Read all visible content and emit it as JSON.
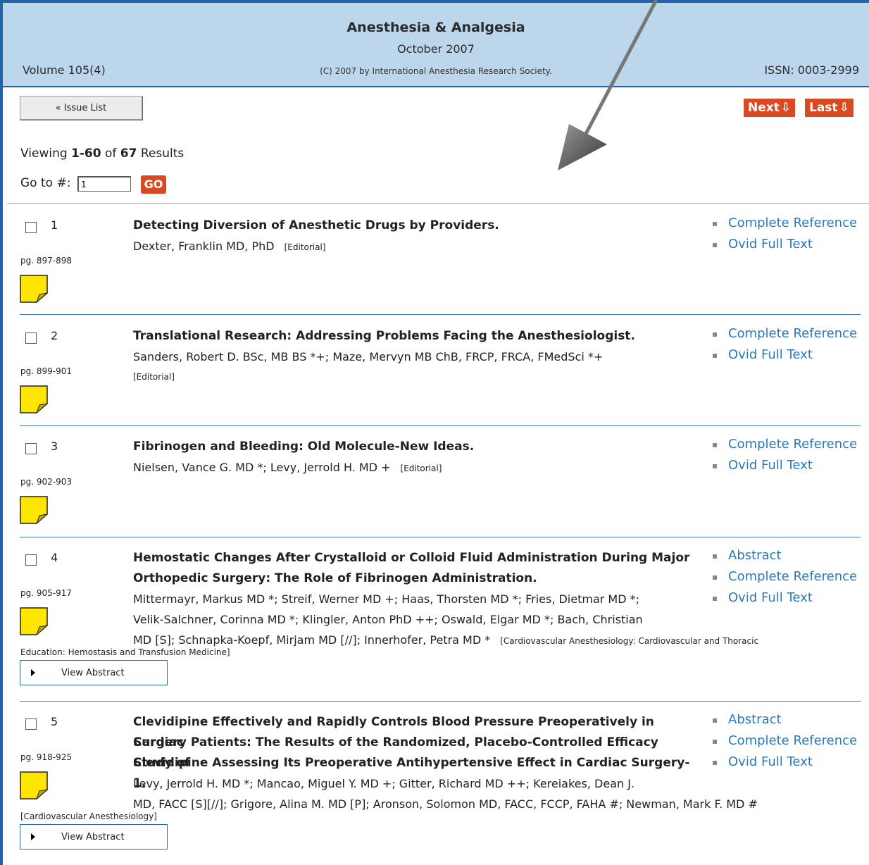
{
  "header": {
    "title": "Anesthesia & Analgesia",
    "date": "October 2007",
    "volume": "Volume 105(4)",
    "copyright": "(C) 2007 by International Anesthesia Research Society.",
    "issn": "ISSN: 0003-2999"
  },
  "toolbar": {
    "issue_list_label": "« Issue List",
    "next_label": "Next",
    "last_label": "Last"
  },
  "results_info": {
    "viewing_prefix": "Viewing ",
    "range": "1-60",
    "of_text": " of ",
    "total": "67",
    "results_word": " Results",
    "goto_label": "Go to #:",
    "goto_value": "1",
    "go_label": "GO"
  },
  "results": [
    {
      "number": "1",
      "pages": "pg. 897-898",
      "title_lines": [
        "Detecting Diversion of Anesthetic Drugs by Providers."
      ],
      "author_lines": [
        "Dexter, Franklin MD, PhD"
      ],
      "tag": "[Editorial]",
      "links": [
        "Complete Reference",
        "Ovid Full Text"
      ]
    },
    {
      "number": "2",
      "pages": "pg. 899-901",
      "title_lines": [
        "Translational Research: Addressing Problems Facing the Anesthesiologist."
      ],
      "author_lines": [
        "Sanders, Robert D. BSc, MB BS *+; Maze, Mervyn MB ChB, FRCP, FRCA, FMedSci *+"
      ],
      "tag": "[Editorial]",
      "links": [
        "Complete Reference",
        "Ovid Full Text"
      ]
    },
    {
      "number": "3",
      "pages": "pg. 902-903",
      "title_lines": [
        "Fibrinogen and Bleeding: Old Molecule-New Ideas."
      ],
      "author_lines": [
        "Nielsen, Vance G. MD *; Levy, Jerrold H. MD +"
      ],
      "tag": "[Editorial]",
      "links": [
        "Complete Reference",
        "Ovid Full Text"
      ]
    },
    {
      "number": "4",
      "pages": "pg. 905-917",
      "title_lines": [
        "Hemostatic Changes After Crystalloid or Colloid Fluid Administration During Major",
        "Orthopedic Surgery: The Role of Fibrinogen Administration."
      ],
      "author_lines": [
        "Mittermayr, Markus MD *; Streif, Werner MD +; Haas, Thorsten MD *; Fries, Dietmar MD *;",
        "Velik-Salchner, Corinna MD *; Klingler, Anton PhD ++; Oswald, Elgar MD *; Bach, Christian",
        "MD [S]; Schnapka-Koepf, Mirjam MD [//]; Innerhofer, Petra MD *"
      ],
      "tag": "[Cardiovascular Anesthesiology: Cardiovascular and Thoracic",
      "tag_cont": "Education: Hemostasis and Transfusion Medicine]",
      "abstract_button": "View Abstract",
      "links": [
        "Abstract",
        "Complete Reference",
        "Ovid Full Text"
      ]
    },
    {
      "number": "5",
      "pages": "pg. 918-925",
      "title_lines": [
        "Clevidipine Effectively and Rapidly Controls Blood Pressure Preoperatively in Cardiac",
        "Surgery Patients: The Results of the Randomized, Placebo-Controlled Efficacy Study of",
        "Clevidipine Assessing Its Preoperative Antihypertensive Effect in Cardiac Surgery-1."
      ],
      "author_lines": [
        "Levy, Jerrold H. MD *; Mancao, Miguel Y. MD +; Gitter, Richard MD ++; Kereiakes, Dean J.",
        "MD, FACC [S][//]; Grigore, Alina M. MD [P]; Aronson, Solomon MD, FACC, FCCP, FAHA #; Newman, Mark F. MD #"
      ],
      "tag_cont": "[Cardiovascular Anesthesiology]",
      "abstract_button": "View Abstract",
      "links": [
        "Abstract",
        "Complete Reference",
        "Ovid Full Text"
      ]
    }
  ]
}
